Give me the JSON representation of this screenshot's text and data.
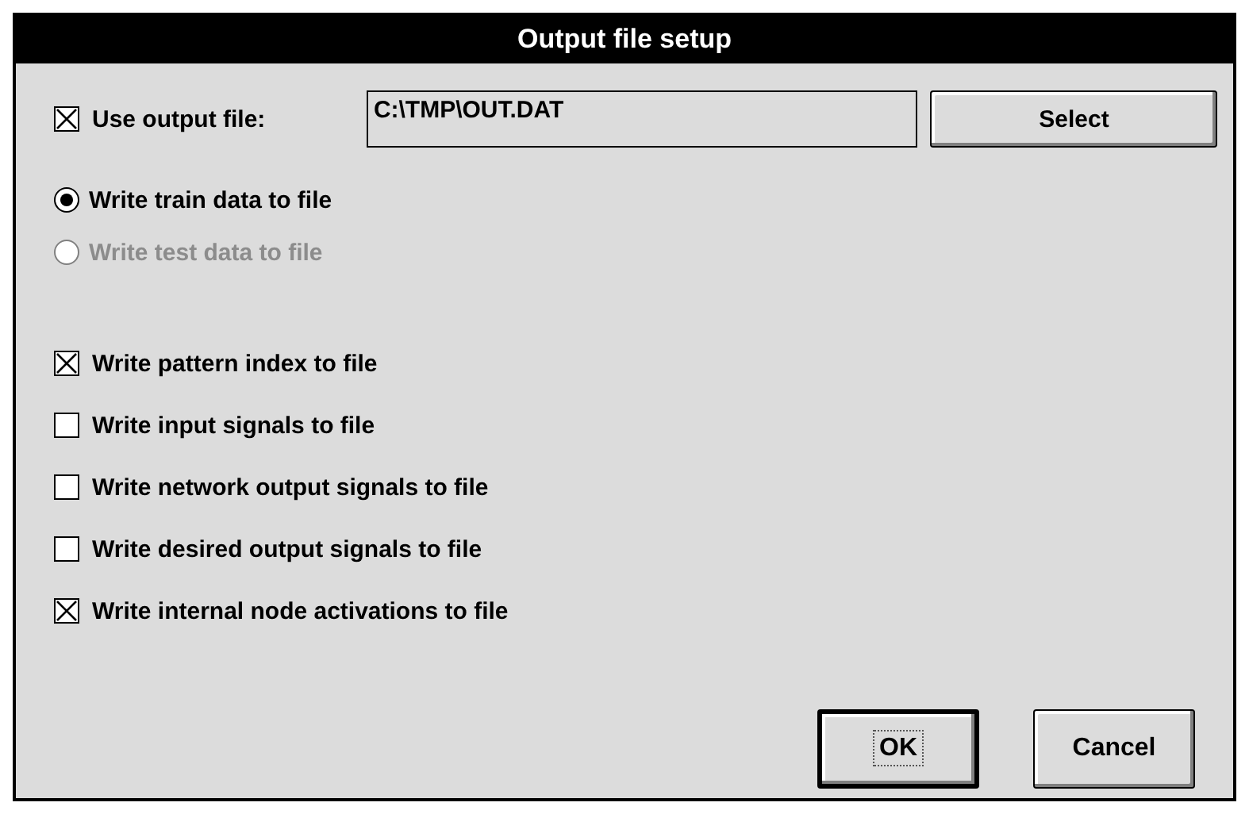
{
  "window": {
    "title": "Output file setup"
  },
  "output_file": {
    "label": "Use output file:",
    "checked": true,
    "value": "C:\\TMP\\OUT.DAT",
    "button": "Select"
  },
  "radios": [
    {
      "label": "Write train data to file",
      "selected": true,
      "disabled": false
    },
    {
      "label": "Write test data to file",
      "selected": false,
      "disabled": true
    }
  ],
  "checkboxes": [
    {
      "label": "Write pattern index to file",
      "checked": true
    },
    {
      "label": "Write input signals to file",
      "checked": false
    },
    {
      "label": "Write network output signals to file",
      "checked": false
    },
    {
      "label": "Write desired output signals to file",
      "checked": false
    },
    {
      "label": "Write internal node activations to file",
      "checked": true
    }
  ],
  "buttons": [
    {
      "label": "OK",
      "default": true
    },
    {
      "label": "Cancel",
      "default": false
    }
  ]
}
